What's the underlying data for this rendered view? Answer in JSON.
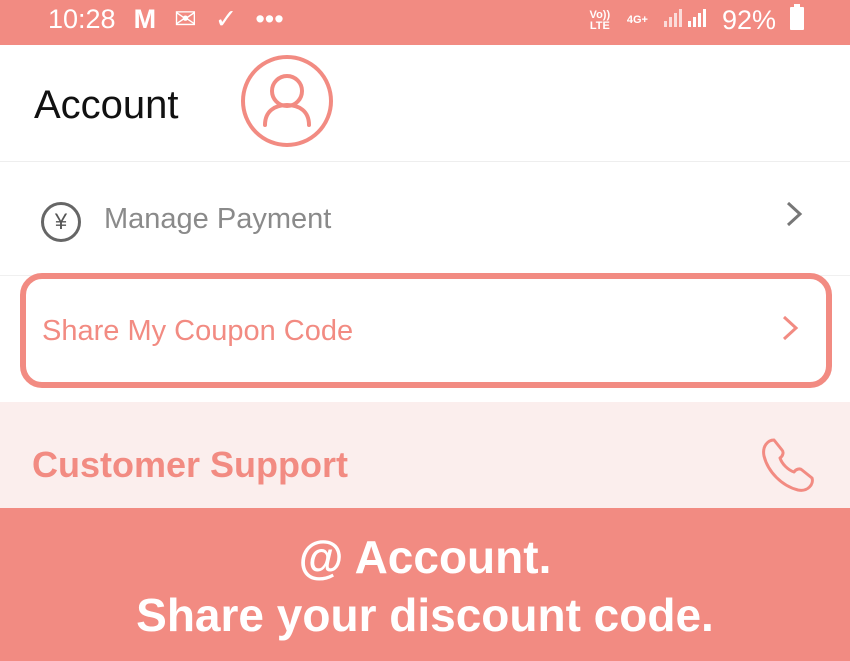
{
  "status_bar": {
    "time": "10:28",
    "notification_icons": [
      "gmail-icon",
      "mail-icon",
      "check-icon",
      "more-dots-icon"
    ],
    "volte": "Vo)) LTE",
    "network": "4G+",
    "battery": "92%"
  },
  "header": {
    "title": "Account"
  },
  "menu": {
    "manage_payment": "Manage Payment",
    "share_coupon": "Share My Coupon Code",
    "customer_support": "Customer Support"
  },
  "banner": {
    "line1": "@ Account.",
    "line2": "Share your discount code."
  },
  "colors": {
    "accent": "#f28b82",
    "support_bg": "#fbeeed"
  }
}
